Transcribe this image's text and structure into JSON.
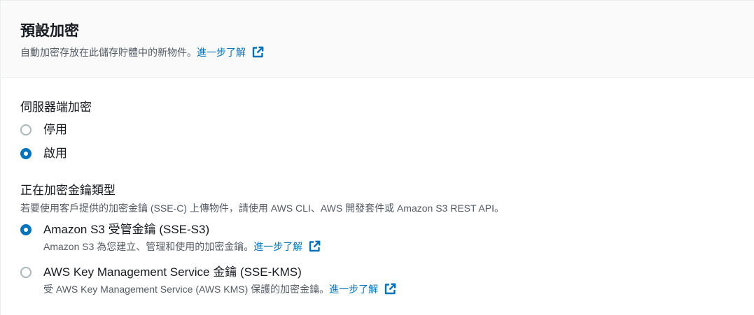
{
  "header": {
    "title": "預設加密",
    "description": "自動加密存放在此儲存貯體中的新物件。",
    "learn_more": "進一步了解"
  },
  "server_side_encryption": {
    "label": "伺服器端加密",
    "options": [
      {
        "label": "停用",
        "selected": false
      },
      {
        "label": "啟用",
        "selected": true
      }
    ]
  },
  "key_type": {
    "label": "正在加密金鑰類型",
    "hint": "若要使用客戶提供的加密金鑰 (SSE-C) 上傳物件，請使用 AWS CLI、AWS 開發套件或 Amazon S3 REST API。",
    "options": [
      {
        "label": "Amazon S3 受管金鑰 (SSE-S3)",
        "description": "Amazon S3 為您建立、管理和使用的加密金鑰。",
        "learn_more": "進一步了解",
        "selected": true
      },
      {
        "label": "AWS Key Management Service 金鑰 (SSE-KMS)",
        "description": "受 AWS Key Management Service (AWS KMS) 保護的加密金鑰。",
        "learn_more": "進一步了解",
        "selected": false
      }
    ]
  },
  "colors": {
    "link": "#0073bb",
    "radio_selected": "#0073bb",
    "radio_unselected": "#aab7b8",
    "header_bg": "#fafafa",
    "text": "#16191f",
    "secondary_text": "#545b64"
  },
  "icons": {
    "external_link": "external-link-icon"
  }
}
